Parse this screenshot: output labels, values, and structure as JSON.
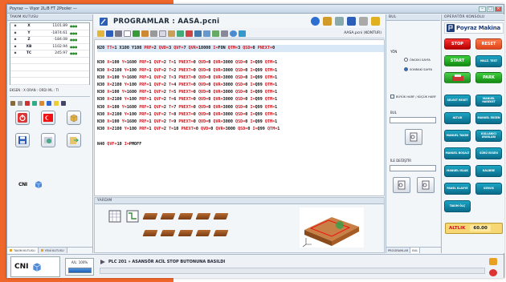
{
  "window": {
    "title": "Poyraz — Vişor 2L/8 FT 2Pooler —"
  },
  "left_panel": {
    "header": "TAKIM KUTUSU",
    "axes": [
      {
        "name": "X",
        "value": "1101.89"
      },
      {
        "name": "Y",
        "value": "-1874.61"
      },
      {
        "name": "Z",
        "value": "-184.08"
      },
      {
        "name": "XB",
        "value": "1102.94"
      },
      {
        "name": "TC",
        "value": "245.97"
      }
    ],
    "axis_footer": "EKSEN : X   ORAN : ORDI   ML : TI",
    "logo_text": "CNI",
    "tabs": [
      "TAKIM KUTUSU",
      "YENİ KUTUSU"
    ]
  },
  "program": {
    "title": "PROGRAMLAR : AASA.pcni",
    "toolbar_file": "AASA.pcni (KONTUR)",
    "lines": [
      "N20 TT=1 X100 Y100 PRF=2 QVD=3 QVF=7 QVR=18000 I=FON QTM=3 QSD=0 PNEXT=0",
      "",
      "N30 X=100 Y=1600 PRF=1 QVF=2 T=1 PNEXT=0 QVD=0 QVR=3000 QSD=0 I=Q99 QTM=1",
      "N30 X=2100 Y=100 PRF=1 QVF=2 T=2 PNEXT=0 QVD=0 QVR=3000 QSD=0 I=Q99 QTM=1",
      "N30 X=100 Y=1600 PRF=1 QVF=2 T=3 PNEXT=0 QVD=0 QVR=3000 QSD=0 I=Q99 QTM=1",
      "N30 X=2100 Y=100 PRF=1 QVF=2 T=4 PNEXT=0 QVD=0 QVR=3000 QSD=0 I=Q99 QTM=1",
      "N30 X=100 Y=1600 PRF=1 QVF=2 T=5 PNEXT=0 QVD=0 QVR=3000 QSD=0 I=Q99 QTM=1",
      "N30 X=2100 Y=100 PRF=1 QVF=2 T=6 PNEXT=0 QVD=0 QVR=3000 QSD=0 I=Q99 QTM=1",
      "N30 X=100 Y=1600 PRF=1 QVF=2 T=7 PNEXT=0 QVD=0 QVR=3000 QSD=0 I=Q99 QTM=1",
      "N30 X=2100 Y=100 PRF=1 QVF=2 T=8 PNEXT=0 QVD=0 QVR=3000 QSD=0 I=Q99 QTM=1",
      "N30 X=100 Y=1600 PRF=1 QVF=2 T=9 PNEXT=0 QVD=0 QVR=3000 QSD=0 I=Q99 QTM=1",
      "N30 X=2100 Y=100 PRF=1 QVF=2 T=10 PNEXT=0 QVD=0 QVR=3000 QSD=0 I=Q99 QTM=1",
      "",
      "N40 QVF=10 I=PMOFF"
    ],
    "highlight_line": 0,
    "help_header": "YARDIM"
  },
  "find_panel": {
    "header": "BUL",
    "direction_label": "YÖN",
    "prev_label": "ÖNCEKİ SAYFA",
    "next_label": "SONRAKİ SAYFA",
    "case_label": "BÜYÜK HARF / KÜÇÜK HARF",
    "find_label": "BUL",
    "replace_label": "İLE DEĞİŞTİR",
    "tabs": [
      "PROGRAMLAR",
      "BUL"
    ]
  },
  "operator_panel": {
    "header": "OPERATÖR KONSOLU",
    "brand": "Poyraz Makina",
    "buttons": {
      "stop": "STOP",
      "reset": "RESET",
      "start": "START",
      "park": "PARK"
    },
    "small_buttons": [
      "MALZ. TEST",
      "SELEKT RESET",
      "MANUEL HAREKET",
      "ALTLIK",
      "MANUEL EKSEN",
      "MANUEL TAKIM",
      "KULLANICI AYARLARI",
      "MANUEL BOŞALT",
      "SÜRÜ EKSEN",
      "MANUEL ISLAK",
      "KALIBRE",
      "PANEL KLAVYE",
      "SERVIS",
      "TAKIM ÖLÇ"
    ],
    "altlik_label": "ALTLIK",
    "altlik_value": "60.00"
  },
  "status": {
    "logo_text": "CNI",
    "progress_label": "A/L: 100%",
    "progress_value": 1.0,
    "plc_message": "PLC 201 » ASANSÖR ACİL STOP BUTONUNA BASILDI"
  }
}
